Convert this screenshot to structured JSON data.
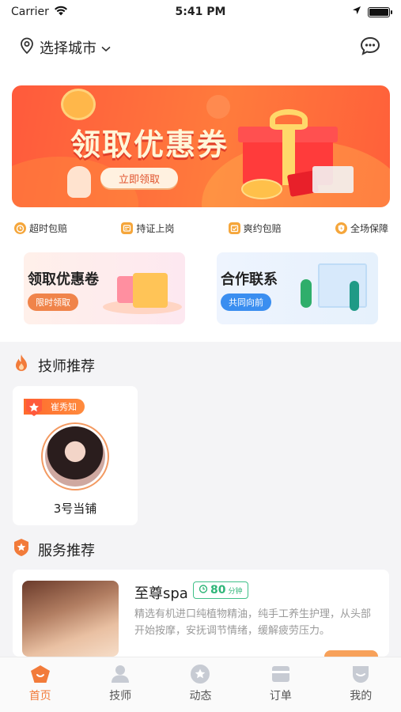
{
  "status_bar": {
    "carrier": "Carrier",
    "time": "5:41 PM"
  },
  "header": {
    "city_label": "选择城市",
    "city_icon": "location-pin-icon",
    "message_icon": "chat-bubble-icon"
  },
  "banner": {
    "title": "领取优惠券",
    "button_label": "立即领取"
  },
  "features": [
    {
      "icon": "alarm-clock-icon",
      "label": "超时包赔"
    },
    {
      "icon": "certificate-icon",
      "label": "持证上岗"
    },
    {
      "icon": "calendar-check-icon",
      "label": "爽约包赔"
    },
    {
      "icon": "shield-icon",
      "label": "全场保障"
    }
  ],
  "promo_cards": [
    {
      "title": "领取优惠卷",
      "button_label": "限时领取"
    },
    {
      "title": "合作联系",
      "button_label": "共同向前"
    }
  ],
  "technician_section": {
    "title": "技师推荐",
    "icon": "flame-icon",
    "items": [
      {
        "tag": "崔秀知",
        "name": "3号当铺"
      }
    ]
  },
  "service_section": {
    "title": "服务推荐",
    "icon": "star-badge-icon",
    "items": [
      {
        "name": "至尊spa",
        "duration_value": "80",
        "duration_unit": "分钟",
        "description": "精选有机进口纯植物精油，纯手工养生护理，从头部开始按摩，安抚调节情绪，缓解疲劳压力。"
      }
    ]
  },
  "tabbar": [
    {
      "label": "首页",
      "icon": "home-icon",
      "active": true
    },
    {
      "label": "技师",
      "icon": "technician-icon",
      "active": false
    },
    {
      "label": "动态",
      "icon": "moments-icon",
      "active": false
    },
    {
      "label": "订单",
      "icon": "order-icon",
      "active": false
    },
    {
      "label": "我的",
      "icon": "profile-icon",
      "active": false
    }
  ],
  "colors": {
    "accent": "#f27b3a",
    "banner": "#ff5a3c",
    "time_badge": "#2fb578",
    "coop_button": "#3a8ef0"
  }
}
